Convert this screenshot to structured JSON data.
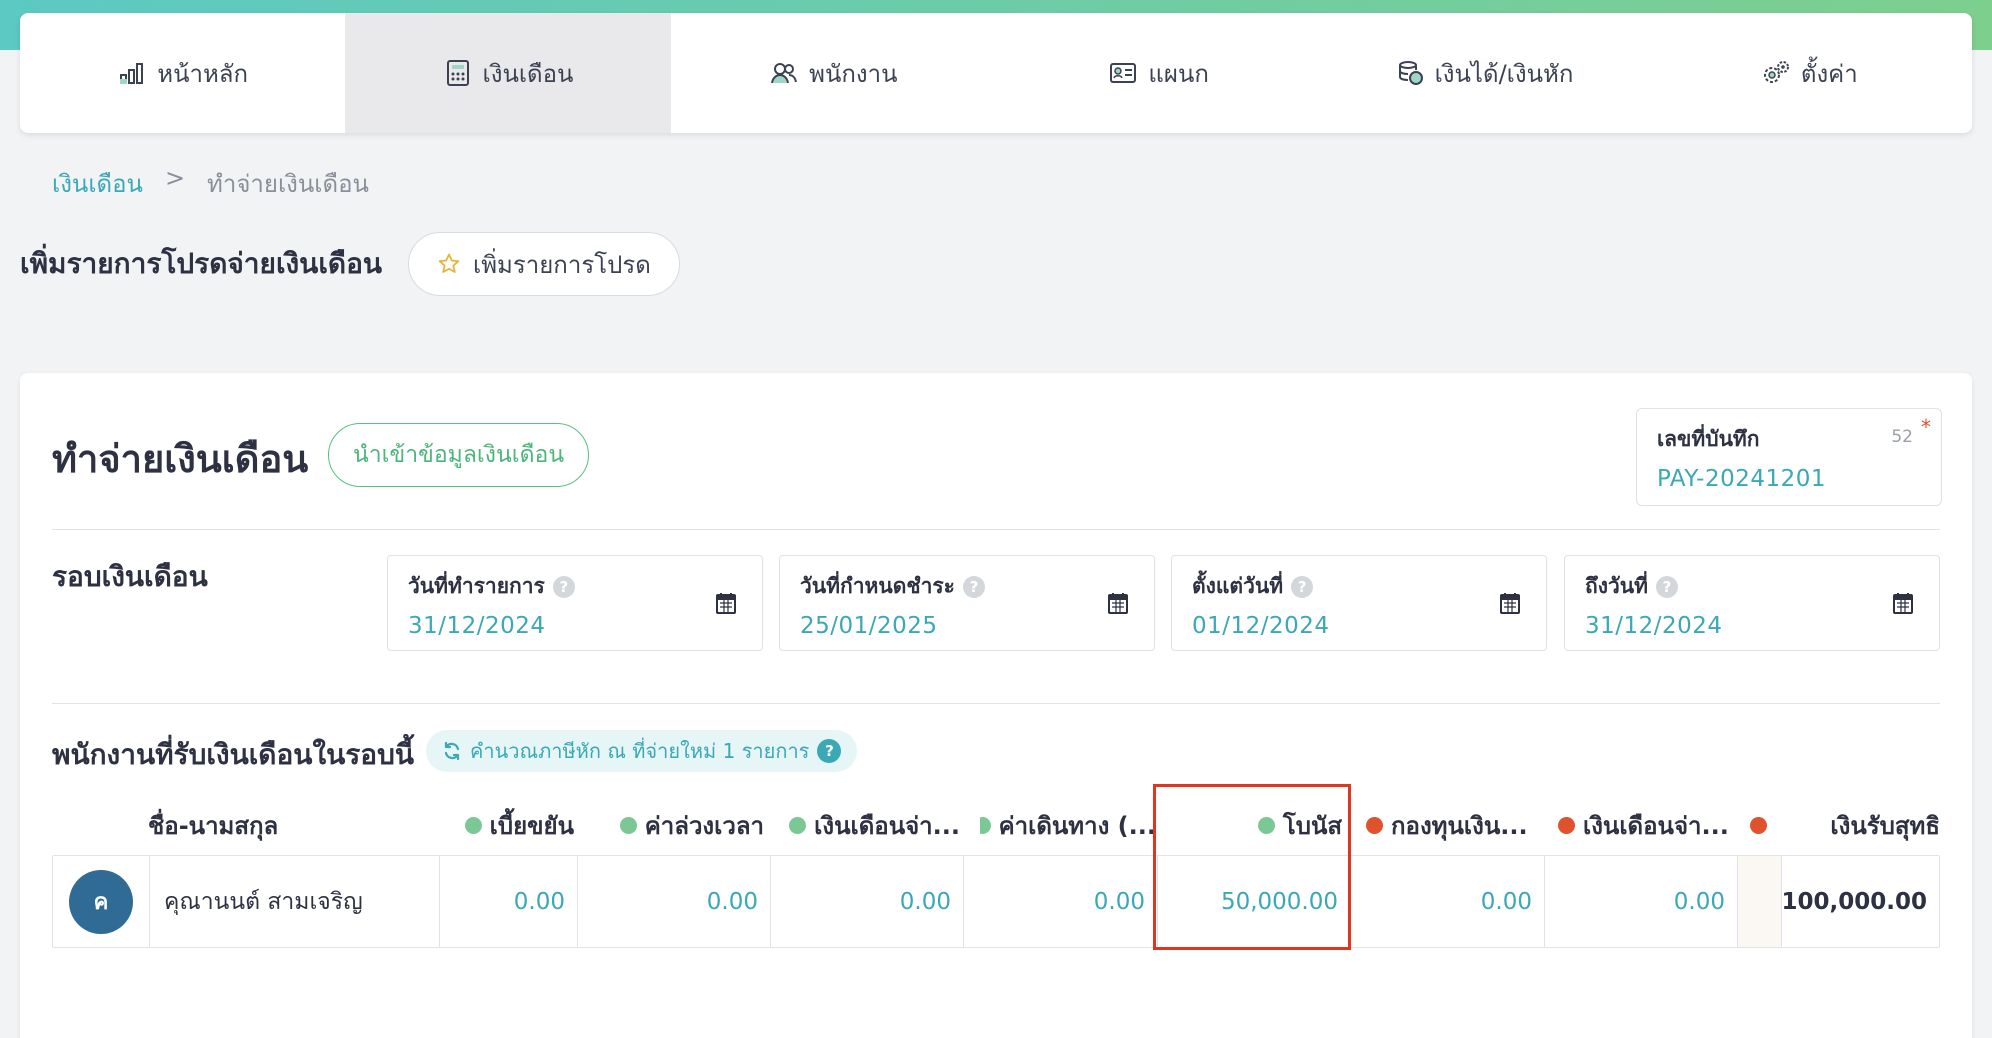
{
  "nav": {
    "items": [
      {
        "label": "หน้าหลัก",
        "icon": "bar-chart-icon"
      },
      {
        "label": "เงินเดือน",
        "icon": "calculator-icon",
        "active": true
      },
      {
        "label": "พนักงาน",
        "icon": "users-icon"
      },
      {
        "label": "แผนก",
        "icon": "id-card-icon"
      },
      {
        "label": "เงินได้/เงินหัก",
        "icon": "coins-icon"
      },
      {
        "label": "ตั้งค่า",
        "icon": "gears-icon"
      }
    ]
  },
  "breadcrumb": {
    "parent": "เงินเดือน",
    "separator": ">",
    "current": "ทำจ่ายเงินเดือน"
  },
  "favorites": {
    "title": "เพิ่มรายการโปรดจ่ายเงินเดือน",
    "button_label": "เพิ่มรายการโปรด"
  },
  "payroll": {
    "title": "ทำจ่ายเงินเดือน",
    "import_button": "นำเข้าข้อมูลเงินเดือน",
    "doc_number": {
      "label": "เลขที่บันทึก",
      "count": "52",
      "required_mark": "*",
      "value": "PAY-20241201"
    },
    "round": {
      "title": "รอบเงินเดือน",
      "fields": [
        {
          "label": "วันที่ทำรายการ",
          "value": "31/12/2024"
        },
        {
          "label": "วันที่กำหนดชำระ",
          "value": "25/01/2025"
        },
        {
          "label": "ตั้งแต่วันที่",
          "value": "01/12/2024"
        },
        {
          "label": "ถึงวันที่",
          "value": "31/12/2024"
        }
      ]
    },
    "employees": {
      "title": "พนักงานที่รับเงินเดือนในรอบนี้",
      "recalc_label": "คำนวณภาษีหัก ณ ที่จ่ายใหม่ 1 รายการ",
      "help_glyph": "?",
      "columns": {
        "name": "ชื่อ-นามสกุล",
        "allowance": "เบี้ยขยัน",
        "overtime": "ค่าล่วงเวลา",
        "salary_pay": "เงินเดือนจ่า...",
        "travel": "ค่าเดินทาง (...",
        "bonus": "โบนัส",
        "fund": "กองทุนเงิน...",
        "salary_deduct": "เงินเดือนจ่า...",
        "net": "เงินรับสุทธิ"
      },
      "rows": [
        {
          "avatar": "ค",
          "name": "คุณานนต์ สามเจริญ",
          "allowance": "0.00",
          "overtime": "0.00",
          "salary_pay": "0.00",
          "travel": "0.00",
          "bonus": "50,000.00",
          "fund": "0.00",
          "salary_deduct": "0.00",
          "net": "100,000.00"
        }
      ]
    }
  },
  "colors": {
    "accent": "#3aa8b5",
    "income_dot": "#7cc894",
    "deduct_dot": "#e0512d",
    "highlight": "#e0351f"
  }
}
